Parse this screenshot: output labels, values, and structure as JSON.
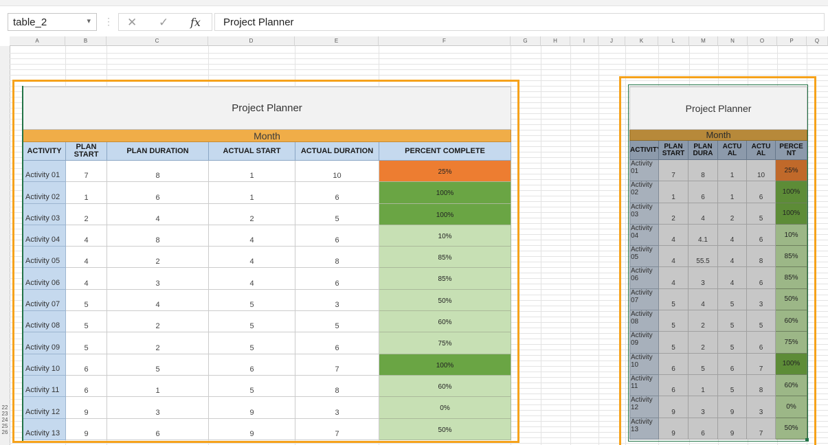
{
  "formula_bar": {
    "name_box": "table_2",
    "dropdown_glyph": "▾",
    "separator": "⋮",
    "cancel_glyph": "✕",
    "enter_glyph": "✓",
    "fx_glyph": "fx",
    "formula_value": "Project Planner"
  },
  "columns": [
    "A",
    "B",
    "C",
    "D",
    "E",
    "F",
    "G",
    "H",
    "I",
    "J",
    "K",
    "L",
    "M",
    "N",
    "O",
    "P",
    "Q"
  ],
  "rows_below": [
    "22",
    "23",
    "24",
    "25",
    "26"
  ],
  "main_table": {
    "title": "Project Planner",
    "month": "Month",
    "headers": [
      "ACTIVITY",
      "PLAN START",
      "PLAN DURATION",
      "ACTUAL START",
      "ACTUAL DURATION",
      "PERCENT COMPLETE"
    ],
    "rows": [
      {
        "activity": "Activity 01",
        "plan_start": "7",
        "plan_duration": "8",
        "actual_start": "1",
        "actual_duration": "10",
        "percent": "25%",
        "pct_value": 0.25
      },
      {
        "activity": "Activity 02",
        "plan_start": "1",
        "plan_duration": "6",
        "actual_start": "1",
        "actual_duration": "6",
        "percent": "100%",
        "pct_value": 1.0
      },
      {
        "activity": "Activity 03",
        "plan_start": "2",
        "plan_duration": "4",
        "actual_start": "2",
        "actual_duration": "5",
        "percent": "100%",
        "pct_value": 1.0
      },
      {
        "activity": "Activity 04",
        "plan_start": "4",
        "plan_duration": "8",
        "actual_start": "4",
        "actual_duration": "6",
        "percent": "10%",
        "pct_value": 0.1
      },
      {
        "activity": "Activity 05",
        "plan_start": "4",
        "plan_duration": "2",
        "actual_start": "4",
        "actual_duration": "8",
        "percent": "85%",
        "pct_value": 0.85
      },
      {
        "activity": "Activity 06",
        "plan_start": "4",
        "plan_duration": "3",
        "actual_start": "4",
        "actual_duration": "6",
        "percent": "85%",
        "pct_value": 0.85
      },
      {
        "activity": "Activity 07",
        "plan_start": "5",
        "plan_duration": "4",
        "actual_start": "5",
        "actual_duration": "3",
        "percent": "50%",
        "pct_value": 0.5
      },
      {
        "activity": "Activity 08",
        "plan_start": "5",
        "plan_duration": "2",
        "actual_start": "5",
        "actual_duration": "5",
        "percent": "60%",
        "pct_value": 0.6
      },
      {
        "activity": "Activity 09",
        "plan_start": "5",
        "plan_duration": "2",
        "actual_start": "5",
        "actual_duration": "6",
        "percent": "75%",
        "pct_value": 0.75
      },
      {
        "activity": "Activity 10",
        "plan_start": "6",
        "plan_duration": "5",
        "actual_start": "6",
        "actual_duration": "7",
        "percent": "100%",
        "pct_value": 1.0
      },
      {
        "activity": "Activity 11",
        "plan_start": "6",
        "plan_duration": "1",
        "actual_start": "5",
        "actual_duration": "8",
        "percent": "60%",
        "pct_value": 0.6
      },
      {
        "activity": "Activity 12",
        "plan_start": "9",
        "plan_duration": "3",
        "actual_start": "9",
        "actual_duration": "3",
        "percent": "0%",
        "pct_value": 0.0
      },
      {
        "activity": "Activity 13",
        "plan_start": "9",
        "plan_duration": "6",
        "actual_start": "9",
        "actual_duration": "7",
        "percent": "50%",
        "pct_value": 0.5
      }
    ]
  },
  "mini_table": {
    "title": "Project Planner",
    "month": "Month",
    "headers": [
      "ACTIVITY",
      "PLAN START",
      "PLAN DURA",
      "ACTU AL",
      "ACTU AL",
      "PERCE NT"
    ],
    "rows": [
      {
        "activity": "Activity 01",
        "plan_start": "7",
        "plan_duration": "8",
        "actual_start": "1",
        "actual_duration": "10",
        "percent": "25%",
        "pct_value": 0.25
      },
      {
        "activity": "Activity 02",
        "plan_start": "1",
        "plan_duration": "6",
        "actual_start": "1",
        "actual_duration": "6",
        "percent": "100%",
        "pct_value": 1.0
      },
      {
        "activity": "Activity 03",
        "plan_start": "2",
        "plan_duration": "4",
        "actual_start": "2",
        "actual_duration": "5",
        "percent": "100%",
        "pct_value": 1.0
      },
      {
        "activity": "Activity 04",
        "plan_start": "4",
        "plan_duration": "4.1",
        "actual_start": "4",
        "actual_duration": "6",
        "percent": "10%",
        "pct_value": 0.1
      },
      {
        "activity": "Activity 05",
        "plan_start": "4",
        "plan_duration": "55.5",
        "actual_start": "4",
        "actual_duration": "8",
        "percent": "85%",
        "pct_value": 0.85
      },
      {
        "activity": "Activity 06",
        "plan_start": "4",
        "plan_duration": "3",
        "actual_start": "4",
        "actual_duration": "6",
        "percent": "85%",
        "pct_value": 0.85
      },
      {
        "activity": "Activity 07",
        "plan_start": "5",
        "plan_duration": "4",
        "actual_start": "5",
        "actual_duration": "3",
        "percent": "50%",
        "pct_value": 0.5
      },
      {
        "activity": "Activity 08",
        "plan_start": "5",
        "plan_duration": "2",
        "actual_start": "5",
        "actual_duration": "5",
        "percent": "60%",
        "pct_value": 0.6
      },
      {
        "activity": "Activity 09",
        "plan_start": "5",
        "plan_duration": "2",
        "actual_start": "5",
        "actual_duration": "6",
        "percent": "75%",
        "pct_value": 0.75
      },
      {
        "activity": "Activity 10",
        "plan_start": "6",
        "plan_duration": "5",
        "actual_start": "6",
        "actual_duration": "7",
        "percent": "100%",
        "pct_value": 1.0
      },
      {
        "activity": "Activity 11",
        "plan_start": "6",
        "plan_duration": "1",
        "actual_start": "5",
        "actual_duration": "8",
        "percent": "60%",
        "pct_value": 0.6
      },
      {
        "activity": "Activity 12",
        "plan_start": "9",
        "plan_duration": "3",
        "actual_start": "9",
        "actual_duration": "3",
        "percent": "0%",
        "pct_value": 0.0
      },
      {
        "activity": "Activity 13",
        "plan_start": "9",
        "plan_duration": "6",
        "actual_start": "9",
        "actual_duration": "7",
        "percent": "50%",
        "pct_value": 0.5
      }
    ]
  },
  "colors": {
    "highlight_frame": "#f6a21b",
    "selection_border": "#217346",
    "pct_warning": "#ed7d31",
    "pct_complete": "#6aa544",
    "pct_partial": "#c7e0b4"
  }
}
